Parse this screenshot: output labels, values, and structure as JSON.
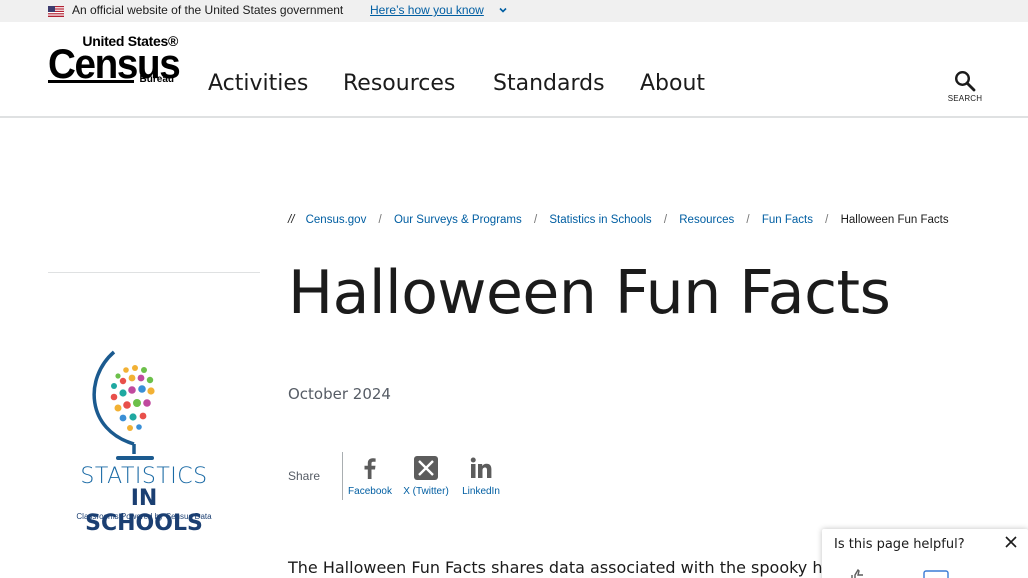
{
  "gov_banner": {
    "text": "An official website of the United States government",
    "link": "Here’s how you know"
  },
  "logo": {
    "line1": "United States®",
    "line2": "Census",
    "line3": "Bureau"
  },
  "nav": {
    "items": [
      {
        "label": "Activities"
      },
      {
        "label": "Resources"
      },
      {
        "label": "Standards"
      },
      {
        "label": "About"
      }
    ],
    "search_label": "SEARCH"
  },
  "breadcrumb": {
    "prefix": "//",
    "items": [
      {
        "label": "Census.gov"
      },
      {
        "label": "Our Surveys & Programs"
      },
      {
        "label": "Statistics in Schools"
      },
      {
        "label": "Resources"
      },
      {
        "label": "Fun Facts"
      }
    ],
    "current": "Halloween Fun Facts",
    "separator": "/"
  },
  "sidebar": {
    "logo_line1": "STATISTICS",
    "logo_line2": "IN SCHOOLS",
    "logo_tagline": "Classrooms Powered by Census Data"
  },
  "main": {
    "title": "Halloween Fun Facts",
    "date": "October 2024",
    "share_label": "Share",
    "share": [
      {
        "label": "Facebook",
        "icon": "facebook-icon"
      },
      {
        "label": "X (Twitter)",
        "icon": "x-twitter-icon"
      },
      {
        "label": "LinkedIn",
        "icon": "linkedin-icon"
      }
    ],
    "intro": "The Halloween Fun Facts shares data associated with the spooky h"
  },
  "feedback": {
    "question": "Is this page helpful?"
  },
  "colors": {
    "link": "#005ea2",
    "banner_bg": "#f0f0f0",
    "text": "#1b1b1b"
  }
}
